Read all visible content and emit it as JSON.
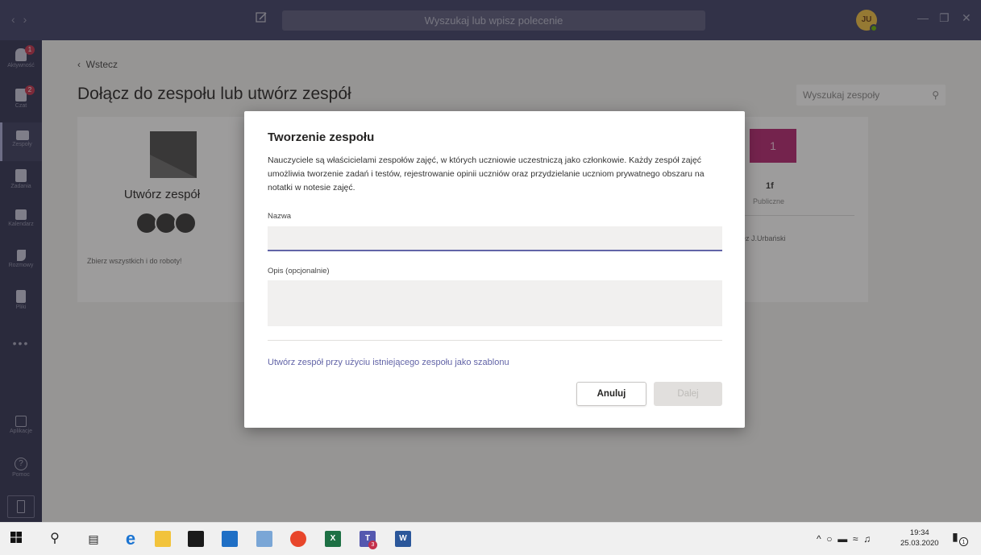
{
  "titlebar": {
    "search_placeholder": "Wyszukaj lub wpisz polecenie",
    "avatar_initials": "JU",
    "nav_back": "‹",
    "nav_forward": "›",
    "minimize": "—",
    "maximize": "❐",
    "close": "✕"
  },
  "rail": {
    "items": [
      {
        "label": "Aktywność",
        "badge": "1"
      },
      {
        "label": "Czat",
        "badge": "2"
      },
      {
        "label": "Zespoły"
      },
      {
        "label": "Zadania"
      },
      {
        "label": "Kalendarz"
      },
      {
        "label": "Rozmowy"
      },
      {
        "label": "Pliki"
      }
    ],
    "more": "•••",
    "apps_label": "Aplikacje",
    "help_label": "Pomoc",
    "help_glyph": "?"
  },
  "main": {
    "back_label": "Wstecz",
    "page_title": "Dołącz do zespołu lub utwórz zespół",
    "team_search_placeholder": "Wyszukaj zespoły",
    "create_card": {
      "title": "Utwórz zespół",
      "description": "Zbierz wszystkich i do roboty!"
    },
    "team_card": {
      "tile_text": "1",
      "name": "1f",
      "visibility": "Publiczne",
      "owner": "ez J.Urbański"
    }
  },
  "dialog": {
    "title": "Tworzenie zespołu",
    "description": "Nauczyciele są właścicielami zespołów zajęć, w których uczniowie uczestniczą jako członkowie. Każdy zespół zajęć umożliwia tworzenie zadań i testów, rejestrowanie opinii uczniów oraz przydzielanie uczniom prywatnego obszaru na notatki w notesie zajęć.",
    "name_label": "Nazwa",
    "name_value": "",
    "desc_label": "Opis (opcjonalnie)",
    "desc_value": "",
    "template_link": "Utwórz zespół przy użyciu istniejącego zespołu jako szablonu",
    "cancel_label": "Anuluj",
    "next_label": "Dalej"
  },
  "taskbar": {
    "teams_badge": "3",
    "time": "19:34",
    "date": "25.03.2020",
    "notification_count": "1"
  },
  "colors": {
    "accent": "#6264a7",
    "titlebar": "#3d3e66",
    "rail": "#2f3050"
  }
}
